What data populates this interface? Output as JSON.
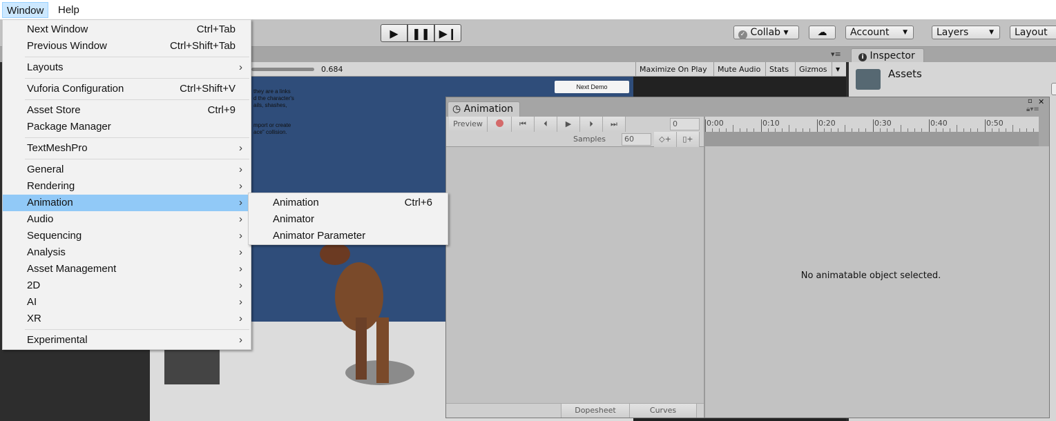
{
  "menubar": {
    "items": [
      "Window",
      "Help"
    ]
  },
  "toolbar": {
    "collab": "Collab ▾",
    "account": "Account",
    "layers": "Layers",
    "layout": "Layout",
    "play_icons": [
      "play-icon",
      "pause-icon",
      "step-icon"
    ]
  },
  "game_view": {
    "scale_value": "0.684",
    "buttons": [
      "Maximize On Play",
      "Mute Audio",
      "Stats",
      "Gizmos"
    ],
    "next_demo": "Next Demo",
    "scene_text": [
      "they are a links",
      "d the character's",
      "ails, shashes,",
      "mport or create",
      "ace\" collision."
    ]
  },
  "inspector": {
    "tab": "Inspector",
    "title": "Assets"
  },
  "window_menu": {
    "items": [
      {
        "label": "Next Window",
        "shortcut": "Ctrl+Tab"
      },
      {
        "label": "Previous Window",
        "shortcut": "Ctrl+Shift+Tab"
      },
      {
        "sep": true
      },
      {
        "label": "Layouts",
        "submenu": true
      },
      {
        "sep": true
      },
      {
        "label": "Vuforia Configuration",
        "shortcut": "Ctrl+Shift+V"
      },
      {
        "sep": true
      },
      {
        "label": "Asset Store",
        "shortcut": "Ctrl+9"
      },
      {
        "label": "Package Manager"
      },
      {
        "sep": true
      },
      {
        "label": "TextMeshPro",
        "submenu": true
      },
      {
        "sep": true
      },
      {
        "label": "General",
        "submenu": true
      },
      {
        "label": "Rendering",
        "submenu": true
      },
      {
        "label": "Animation",
        "submenu": true,
        "highlighted": true
      },
      {
        "label": "Audio",
        "submenu": true
      },
      {
        "label": "Sequencing",
        "submenu": true
      },
      {
        "label": "Analysis",
        "submenu": true
      },
      {
        "label": "Asset Management",
        "submenu": true
      },
      {
        "label": "2D",
        "submenu": true
      },
      {
        "label": "AI",
        "submenu": true
      },
      {
        "label": "XR",
        "submenu": true
      },
      {
        "sep": true
      },
      {
        "label": "Experimental",
        "submenu": true
      }
    ]
  },
  "animation_submenu": {
    "items": [
      {
        "label": "Animation",
        "shortcut": "Ctrl+6"
      },
      {
        "label": "Animator"
      },
      {
        "label": "Animator Parameter"
      }
    ]
  },
  "animation_window": {
    "tab": "Animation",
    "preview": "Preview",
    "frame": "0",
    "samples_label": "Samples",
    "samples": "60",
    "ruler": [
      "0:00",
      "0:10",
      "0:20",
      "0:30",
      "0:40",
      "0:50"
    ],
    "empty_message": "No animatable object selected.",
    "bottom_tabs": [
      "Dopesheet",
      "Curves"
    ]
  },
  "colors": {
    "menu_highlight": "#91c9f7",
    "scene_blue": "#2f4d7a",
    "record": "#d46a6a"
  }
}
